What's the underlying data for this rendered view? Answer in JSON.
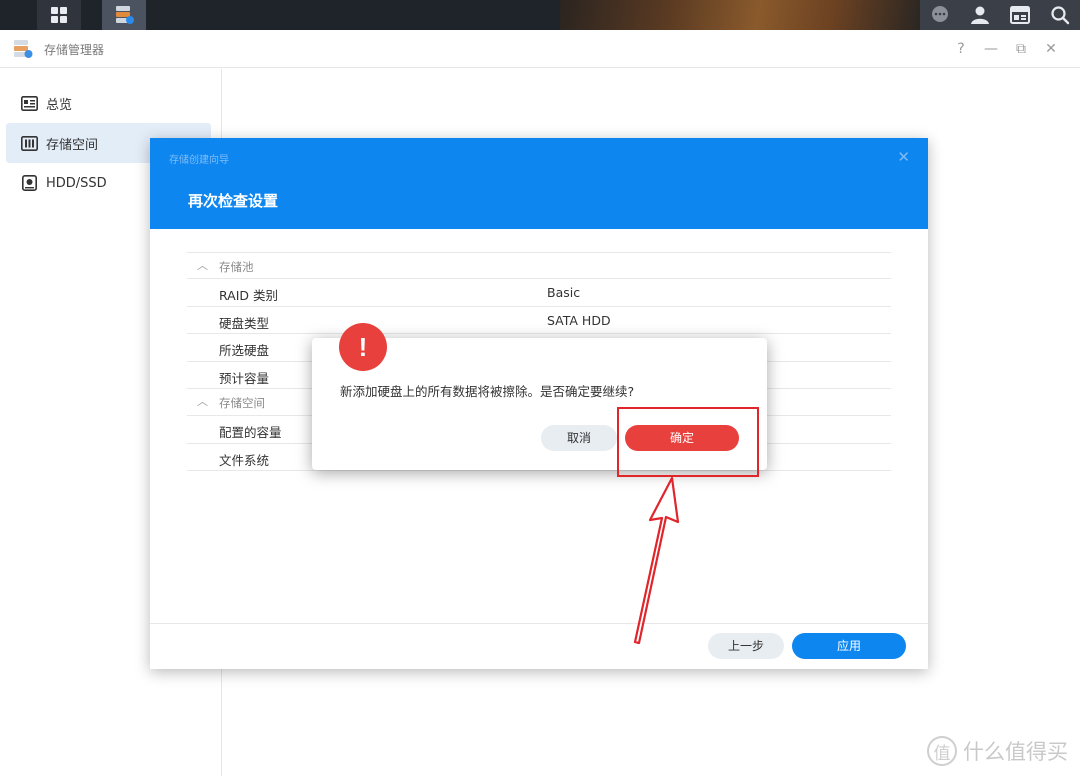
{
  "app": {
    "title": "存储管理器",
    "window_controls": {
      "help": "?",
      "minimize": "—",
      "restore": "⧉",
      "close": "✕"
    }
  },
  "sidebar": {
    "items": [
      {
        "label": "总览",
        "icon": "overview-icon",
        "active": false
      },
      {
        "label": "存储空间",
        "icon": "storage-icon",
        "active": true
      },
      {
        "label": "HDD/SSD",
        "icon": "disk-icon",
        "active": false
      }
    ]
  },
  "wizard": {
    "window_title": "存储创建向导",
    "heading": "再次检查设置",
    "close": "✕",
    "sections": [
      {
        "title": "存储池",
        "rows": [
          {
            "key": "RAID 类别",
            "value": "Basic"
          },
          {
            "key": "硬盘类型",
            "value": "SATA HDD"
          },
          {
            "key": "所选硬盘",
            "value": ""
          },
          {
            "key": "预计容量",
            "value": ""
          }
        ]
      },
      {
        "title": "存储空间",
        "rows": [
          {
            "key": "配置的容量",
            "value": ""
          },
          {
            "key": "文件系统",
            "value": ""
          }
        ]
      }
    ],
    "prev_label": "上一步",
    "apply_label": "应用"
  },
  "confirm": {
    "badge": "!",
    "message": "新添加硬盘上的所有数据将被擦除。是否确定要继续?",
    "cancel_label": "取消",
    "ok_label": "确定"
  },
  "watermark": {
    "logo": "值",
    "text": "什么值得买"
  },
  "colors": {
    "primary": "#0d86f0",
    "danger": "#e8403c",
    "annotation": "#e0252b"
  }
}
